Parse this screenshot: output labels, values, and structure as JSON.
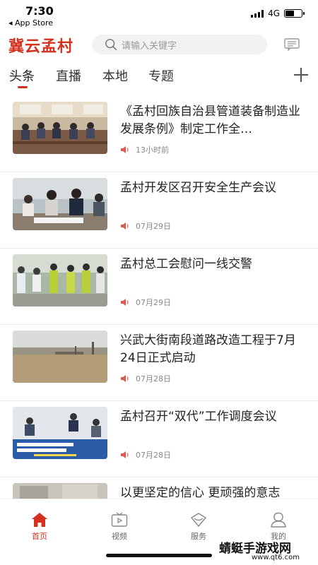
{
  "status": {
    "time": "7:30",
    "back_app": "◂ App Store",
    "network": "4G",
    "battery_level": 0.55
  },
  "header": {
    "logo": "冀云孟村",
    "search_placeholder": "请输入关键字",
    "icons": {
      "search": "search-icon",
      "message": "message-icon"
    }
  },
  "tabs": [
    {
      "label": "头条",
      "active": true
    },
    {
      "label": "直播",
      "active": false
    },
    {
      "label": "本地",
      "active": false
    },
    {
      "label": "专题",
      "active": false
    }
  ],
  "news": [
    {
      "title": "《孟村回族自治县管道装备制造业发展条例》制定工作全…",
      "time": "13小时前"
    },
    {
      "title": "孟村开发区召开安全生产会议",
      "time": "07月29日"
    },
    {
      "title": "孟村总工会慰问一线交警",
      "time": "07月29日"
    },
    {
      "title": "兴武大街南段道路改造工程于7月24日正式启动",
      "time": "07月28日"
    },
    {
      "title": "孟村召开“双代”工作调度会议",
      "time": "07月28日"
    },
    {
      "title": "以更坚定的信心 更顽强的意志",
      "time": ""
    }
  ],
  "bottom_nav": [
    {
      "label": "首页",
      "icon": "home-icon",
      "active": true
    },
    {
      "label": "视频",
      "icon": "tv-icon",
      "active": false
    },
    {
      "label": "服务",
      "icon": "diamond-icon",
      "active": false
    },
    {
      "label": "我的",
      "icon": "user-icon",
      "active": false
    }
  ],
  "watermark": {
    "text": "蜻蜓手游戏网",
    "url": "www.qt6.com"
  },
  "colors": {
    "accent": "#d2321f",
    "text": "#222222",
    "meta": "#888888"
  }
}
